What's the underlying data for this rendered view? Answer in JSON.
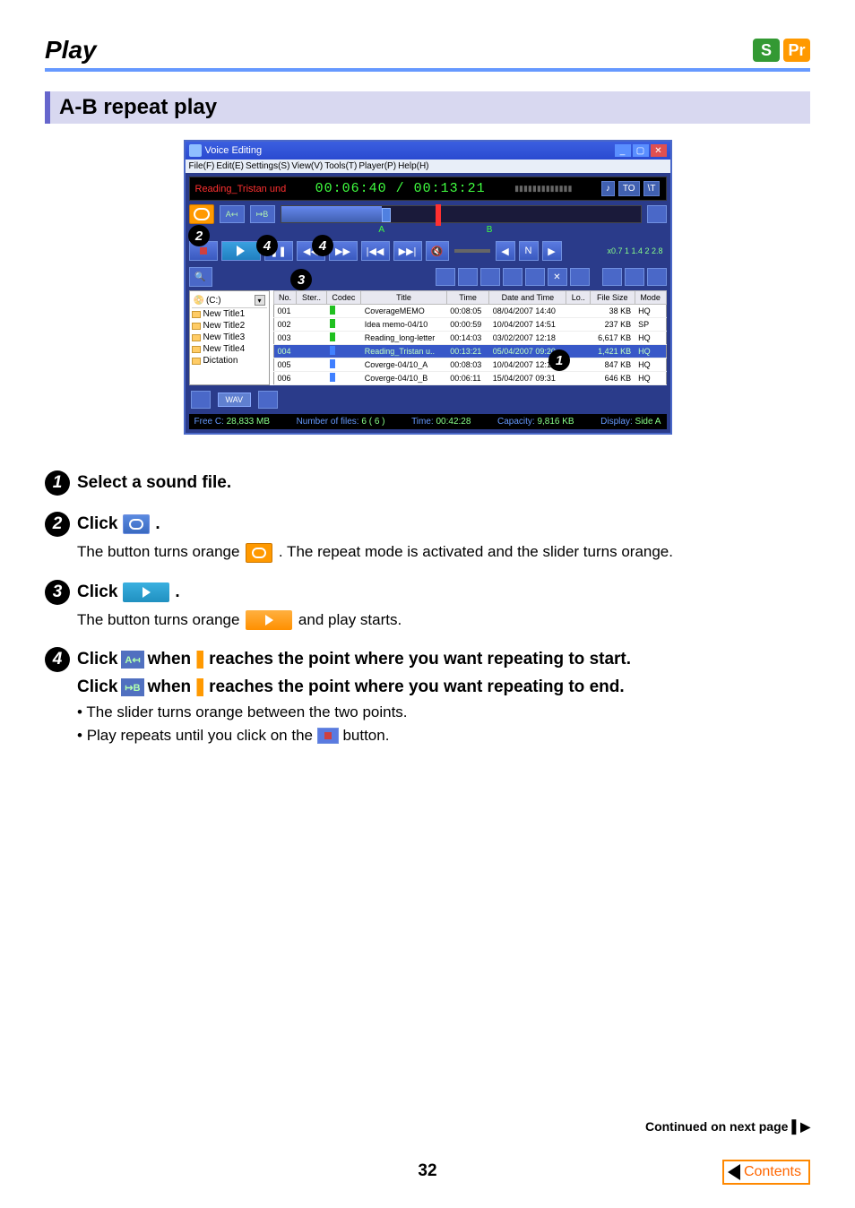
{
  "page": {
    "header_title": "Play",
    "section_title": "A-B repeat play",
    "page_number": "32",
    "continued": "Continued on next page",
    "contents": "Contents"
  },
  "badges": {
    "s": "S",
    "pr": "Pr"
  },
  "app": {
    "title": "Voice Editing",
    "menu": {
      "file": "File(F)",
      "edit": "Edit(E)",
      "settings": "Settings(S)",
      "view": "View(V)",
      "tools": "Tools(T)",
      "player": "Player(P)",
      "help": "Help(H)"
    },
    "display": {
      "filename": "Reading_Tristan und",
      "time": "00:06:40 / 00:13:21",
      "btn1": "♪",
      "btn2": "TO",
      "btn3": "\\T"
    },
    "slider": {
      "a_label": "A",
      "b_label": "B"
    },
    "speed": "x0.7   1   1.4   2   2.8",
    "tree": {
      "drive": "(C:)",
      "items": [
        "New Title1",
        "New Title2",
        "New Title3",
        "New Title4",
        "Dictation"
      ]
    },
    "table": {
      "headers": {
        "no": "No.",
        "ster": "Ster..",
        "codec": "Codec",
        "title": "Title",
        "time": "Time",
        "date": "Date and Time",
        "lo": "Lo..",
        "size": "File Size",
        "mode": "Mode"
      },
      "rows": [
        {
          "no": "001",
          "title": "CoverageMEMO",
          "time": "00:08:05",
          "date": "08/04/2007 14:40",
          "size": "38 KB",
          "mode": "HQ",
          "codec": "g"
        },
        {
          "no": "002",
          "title": "Idea memo-04/10",
          "time": "00:00:59",
          "date": "10/04/2007 14:51",
          "size": "237 KB",
          "mode": "SP",
          "codec": "g"
        },
        {
          "no": "003",
          "title": "Reading_long-letter",
          "time": "00:14:03",
          "date": "03/02/2007 12:18",
          "size": "6,617 KB",
          "mode": "HQ",
          "codec": "g"
        },
        {
          "no": "004",
          "title": "Reading_Tristan u..",
          "time": "00:13:21",
          "date": "05/04/2007 09:20",
          "size": "1,421 KB",
          "mode": "HQ",
          "codec": "b",
          "selected": true
        },
        {
          "no": "005",
          "title": "Coverge-04/10_A",
          "time": "00:08:03",
          "date": "10/04/2007 12:11",
          "size": "847 KB",
          "mode": "HQ",
          "codec": "b"
        },
        {
          "no": "006",
          "title": "Coverge-04/10_B",
          "time": "00:06:11",
          "date": "15/04/2007 09:31",
          "size": "646 KB",
          "mode": "HQ",
          "codec": "b"
        }
      ]
    },
    "wav_label": "WAV",
    "status": {
      "free_label": "Free C:",
      "free_val": "28,833 MB",
      "num_label": "Number of files:",
      "num_val": "6 ( 6 )",
      "time_label": "Time:",
      "time_val": "00:42:28",
      "cap_label": "Capacity:",
      "cap_val": "9,816 KB",
      "disp_label": "Display:",
      "disp_val": "Side A"
    }
  },
  "callouts": {
    "c1": "1",
    "c2": "2",
    "c3": "3",
    "c4a": "4",
    "c4b": "4"
  },
  "steps": {
    "s1": {
      "title": "Select a sound file."
    },
    "s2": {
      "title_1": "Click ",
      "title_2": ".",
      "body": "The button turns orange ",
      "body2": ". The repeat mode is activated and the slider turns orange."
    },
    "s3": {
      "title_1": "Click ",
      "title_2": ".",
      "body1": "The button turns orange ",
      "body2": " and play starts."
    },
    "s4": {
      "line1_a": "Click ",
      "line1_b": " when ",
      "line1_c": " reaches the point where you want repeating to start.",
      "line2_a": "Click ",
      "line2_b": " when ",
      "line2_c": " reaches the point where you want repeating to end.",
      "bullet1": "The slider turns orange between the two points.",
      "bullet2a": "Play repeats until you click on the ",
      "bullet2b": " button.",
      "a_label": "A↤",
      "b_label": "↦B"
    }
  }
}
